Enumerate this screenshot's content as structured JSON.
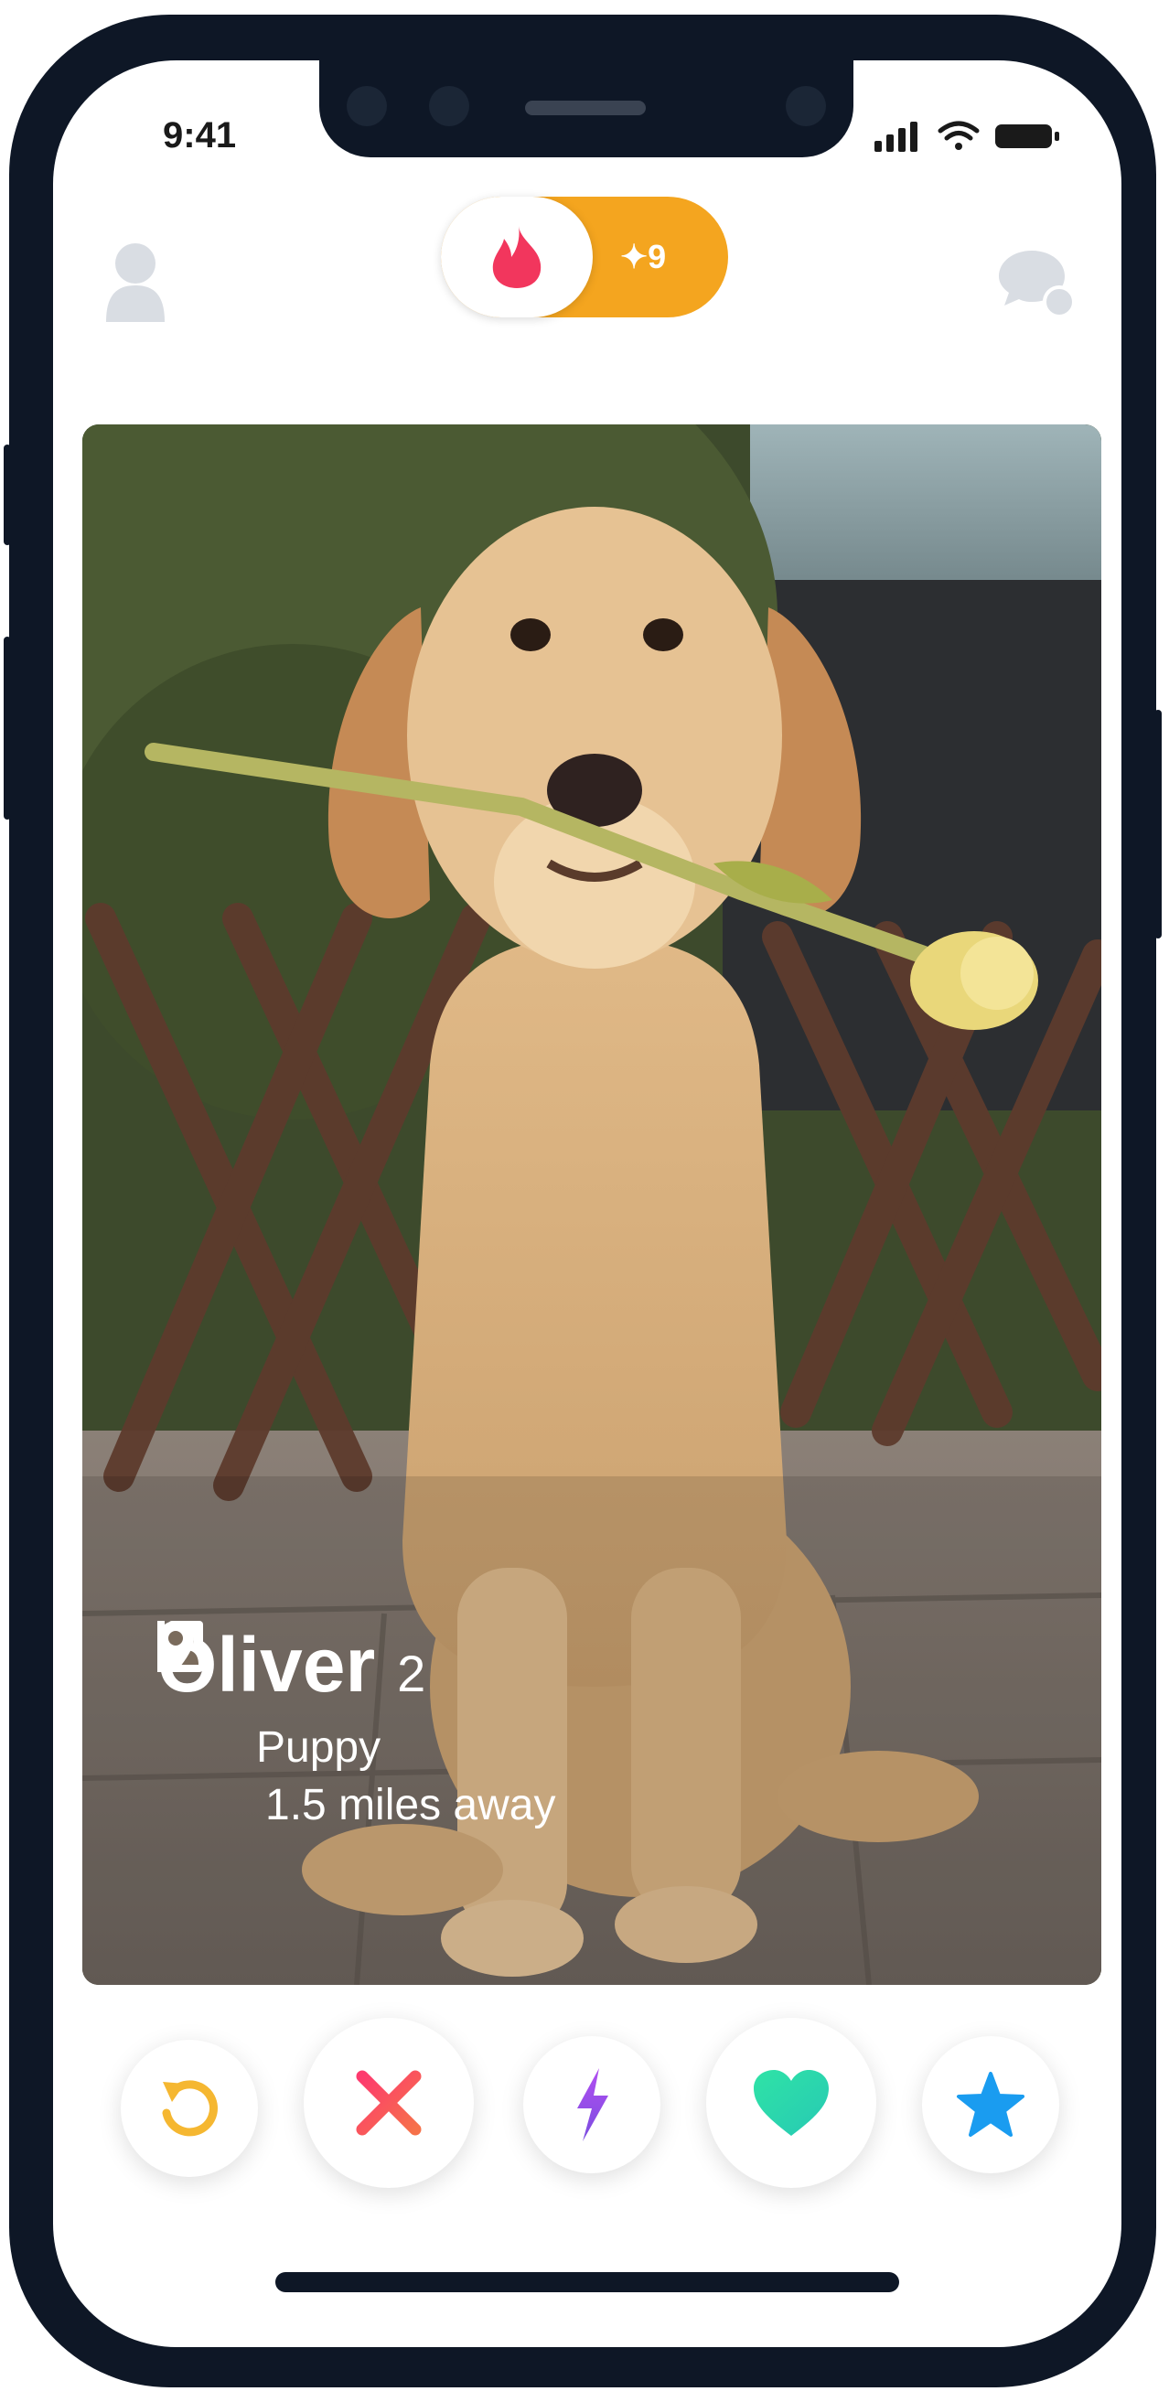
{
  "status_bar": {
    "time": "9:41"
  },
  "header": {
    "profile_icon": "person-icon",
    "chat_icon": "chat-bubbles-icon",
    "toggle": {
      "active": "flame-icon",
      "boost_label": "✦9"
    }
  },
  "card": {
    "name": "Oliver",
    "age": "2",
    "category": "Puppy",
    "distance": "1.5 miles away",
    "photo": "golden retriever puppy holding a yellow tulip"
  },
  "actions": [
    {
      "name": "rewind",
      "icon": "rewind-icon",
      "color": "#f5b731"
    },
    {
      "name": "nope",
      "icon": "x-icon",
      "color": "#f7545c"
    },
    {
      "name": "boost",
      "icon": "lightning-icon",
      "color": "#8b4ee5"
    },
    {
      "name": "like",
      "icon": "heart-icon",
      "color": "#2ee0a8"
    },
    {
      "name": "super-like",
      "icon": "star-icon",
      "color": "#1a9cf0"
    }
  ],
  "colors": {
    "flame": "#f2365d",
    "boost": "#f4a51f",
    "bezel": "#0e1726"
  }
}
